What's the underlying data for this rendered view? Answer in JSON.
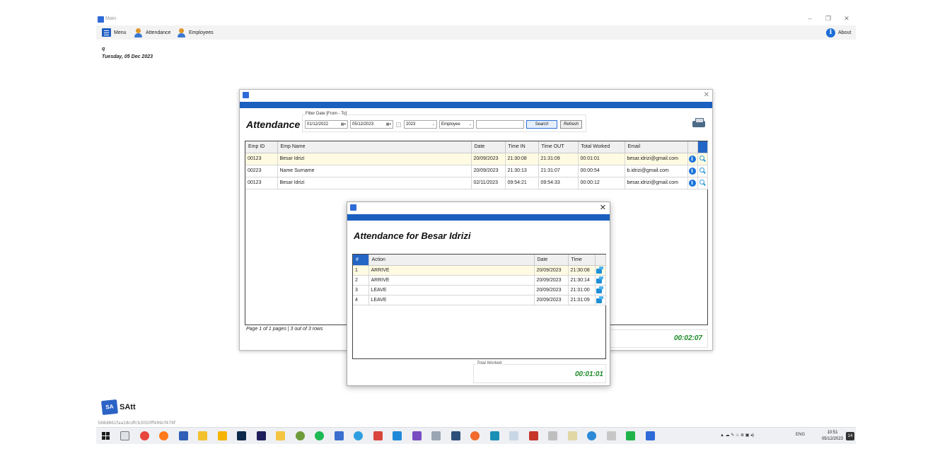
{
  "app": {
    "title": "Main",
    "user": "q",
    "date": "Tuesday, 05 Dec 2023",
    "brand": "SAtt",
    "hash": "568d861faa18cdfcb3050ff499cf479f"
  },
  "window_controls": {
    "minimize": "–",
    "restore": "❐",
    "close": "✕"
  },
  "menubar": {
    "menu": "Menu",
    "attendance": "Attendance",
    "employees": "Employees",
    "about": "About"
  },
  "attendance": {
    "heading": "Attendance",
    "filter_legend": "Filter Date [From - To]",
    "date_from": "01/12/2022",
    "date_to": "05/12/2023",
    "year": "2023",
    "employee": "Employee",
    "search_value": "",
    "search_label": "Search",
    "refresh_label": "Refresh",
    "columns": [
      "Emp ID",
      "Emp Name",
      "Date",
      "Time IN",
      "Time OUT",
      "Total Worked",
      "Email"
    ],
    "rows": [
      {
        "id": "00123",
        "name": "Besar Idrizi",
        "date": "20/09/2023",
        "in": "21:30:08",
        "out": "21:31:09",
        "total": "00:01:01",
        "email": "besar.idrizi@gmail.com"
      },
      {
        "id": "00223",
        "name": "Name Surname",
        "date": "20/09/2023",
        "in": "21:30:13",
        "out": "21:31:07",
        "total": "00:00:54",
        "email": "b.idrizi@gmail.com"
      },
      {
        "id": "00123",
        "name": "Besar Idrizi",
        "date": "02/11/2023",
        "in": "09:54:21",
        "out": "09:54:33",
        "total": "00:00:12",
        "email": "besar.idrizi@gmail.com"
      }
    ],
    "pager": "Page 1 of 1 pages | 3 out of 3 rows",
    "total": "00:02:07",
    "close": "✕"
  },
  "detail": {
    "heading": "Attendance for Besar Idrizi",
    "columns": [
      "#",
      "Action",
      "Date",
      "Time"
    ],
    "rows": [
      {
        "n": "1",
        "action": "ARRIVE",
        "date": "20/09/2023",
        "time": "21:30:08"
      },
      {
        "n": "2",
        "action": "ARRIVE",
        "date": "20/09/2023",
        "time": "21:30:14"
      },
      {
        "n": "3",
        "action": "LEAVE",
        "date": "20/09/2023",
        "time": "21:31:00"
      },
      {
        "n": "4",
        "action": "LEAVE",
        "date": "20/09/2023",
        "time": "21:31:09"
      }
    ],
    "total_legend": "Total Worked",
    "total": "00:01:01",
    "close": "✕"
  },
  "taskbar": {
    "lang": "ENG",
    "time": "10:51",
    "date": "05/12/2023",
    "notifications": "14"
  },
  "colors": {
    "accent": "#1b5fbf",
    "total_green": "#1d8a2b",
    "selected_row": "#fffbe2"
  },
  "icons": [
    "menu-icon",
    "attendance-icon",
    "employees-icon",
    "about-icon",
    "print-icon",
    "info-icon",
    "search-icon",
    "share-icon"
  ]
}
